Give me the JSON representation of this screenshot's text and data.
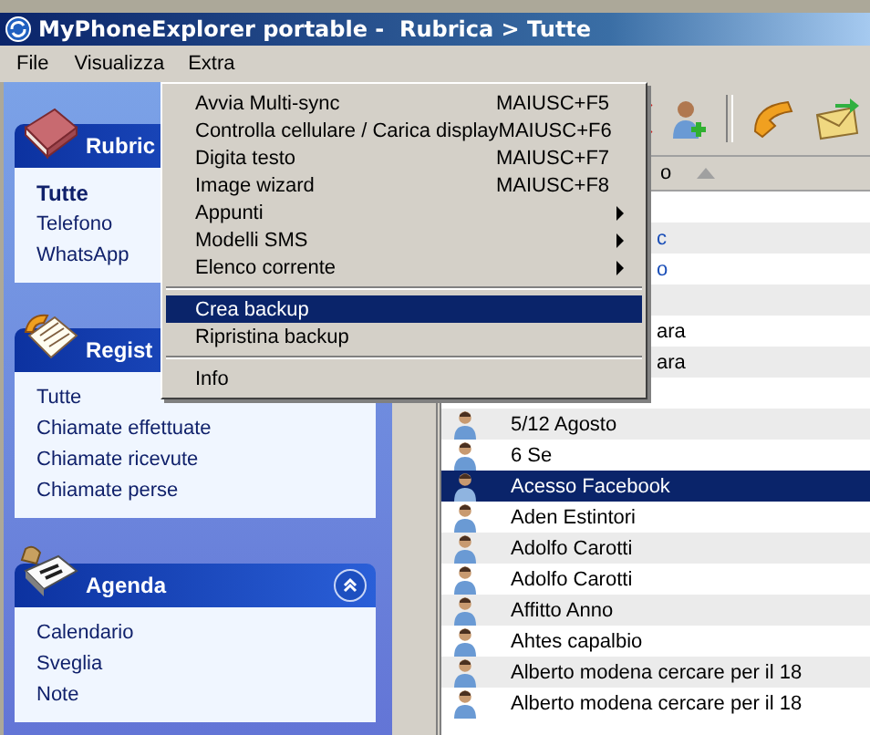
{
  "window": {
    "title": "MyPhoneExplorer portable -  Rubrica > Tutte"
  },
  "menu_bar": [
    {
      "label": "File",
      "selected": false
    },
    {
      "label": "Visualizza",
      "selected": false
    },
    {
      "label": "Extra",
      "selected": true
    }
  ],
  "extra_menu": [
    {
      "kind": "item",
      "label": "Avvia Multi-sync",
      "shortcut": "MAIUSC+F5",
      "selected": false
    },
    {
      "kind": "item",
      "label": "Controlla cellulare / Carica display",
      "shortcut": "MAIUSC+F6",
      "selected": false
    },
    {
      "kind": "item",
      "label": "Digita testo",
      "shortcut": "MAIUSC+F7",
      "selected": false
    },
    {
      "kind": "item",
      "label": "Image wizard",
      "shortcut": "MAIUSC+F8",
      "selected": false
    },
    {
      "kind": "submenu",
      "label": "Appunti",
      "selected": false
    },
    {
      "kind": "submenu",
      "label": "Modelli SMS",
      "selected": false
    },
    {
      "kind": "submenu",
      "label": "Elenco corrente",
      "selected": false
    },
    {
      "kind": "separator"
    },
    {
      "kind": "item",
      "label": "Crea backup",
      "selected": true
    },
    {
      "kind": "item",
      "label": "Ripristina backup",
      "selected": false
    },
    {
      "kind": "separator"
    },
    {
      "kind": "item",
      "label": "Info",
      "selected": false
    }
  ],
  "sidebar": [
    {
      "kind": "book",
      "title": "Rubric",
      "items": [
        {
          "label": "Tutte",
          "selected": true
        },
        {
          "label": "Telefono",
          "selected": false
        },
        {
          "label": "WhatsApp",
          "selected": false
        }
      ]
    },
    {
      "kind": "calls",
      "title": "Regist",
      "items": [
        {
          "label": "Tutte",
          "selected": false
        },
        {
          "label": "Chiamate effettuate",
          "selected": false
        },
        {
          "label": "Chiamate ricevute",
          "selected": false
        },
        {
          "label": "Chiamate perse",
          "selected": false
        }
      ]
    },
    {
      "kind": "calendar",
      "title": "Agenda",
      "collapse_button": true,
      "items": [
        {
          "label": "Calendario",
          "selected": false
        },
        {
          "label": "Sveglia",
          "selected": false
        },
        {
          "label": "Note",
          "selected": false
        }
      ]
    }
  ],
  "list": {
    "header": "o",
    "rows": [
      {
        "kind": "blank"
      },
      {
        "kind": "partial",
        "name": "c",
        "color": "#1b4fb8",
        "selected": false
      },
      {
        "kind": "partial",
        "name": "o",
        "color": "#1b4fb8",
        "selected": false
      },
      {
        "kind": "blank"
      },
      {
        "kind": "partial",
        "name": "ara",
        "color": "#000000",
        "selected": false
      },
      {
        "kind": "partial",
        "name": "ara",
        "color": "#000000",
        "selected": false
      },
      {
        "kind": "blank"
      },
      {
        "kind": "contact",
        "name": "5/12 Agosto",
        "color": "#000000",
        "selected": false
      },
      {
        "kind": "contact",
        "name": "6 Se",
        "color": "#000000",
        "selected": false
      },
      {
        "kind": "contact",
        "name": "Acesso Facebook",
        "color": "#ffffff",
        "selected": true
      },
      {
        "kind": "contact",
        "name": "Aden Estintori",
        "color": "#000000",
        "selected": false
      },
      {
        "kind": "contact",
        "name": "Adolfo Carotti",
        "color": "#000000",
        "selected": false
      },
      {
        "kind": "contact",
        "name": "Adolfo Carotti",
        "color": "#000000",
        "selected": false
      },
      {
        "kind": "contact",
        "name": "Affitto Anno",
        "color": "#000000",
        "selected": false
      },
      {
        "kind": "contact",
        "name": "Ahtes capalbio",
        "color": "#000000",
        "selected": false
      },
      {
        "kind": "contact",
        "name": "Alberto modena cercare per il 18",
        "color": "#000000",
        "selected": false
      },
      {
        "kind": "contact",
        "name": "Alberto modena cercare per il 18",
        "color": "#000000",
        "selected": false
      }
    ]
  }
}
